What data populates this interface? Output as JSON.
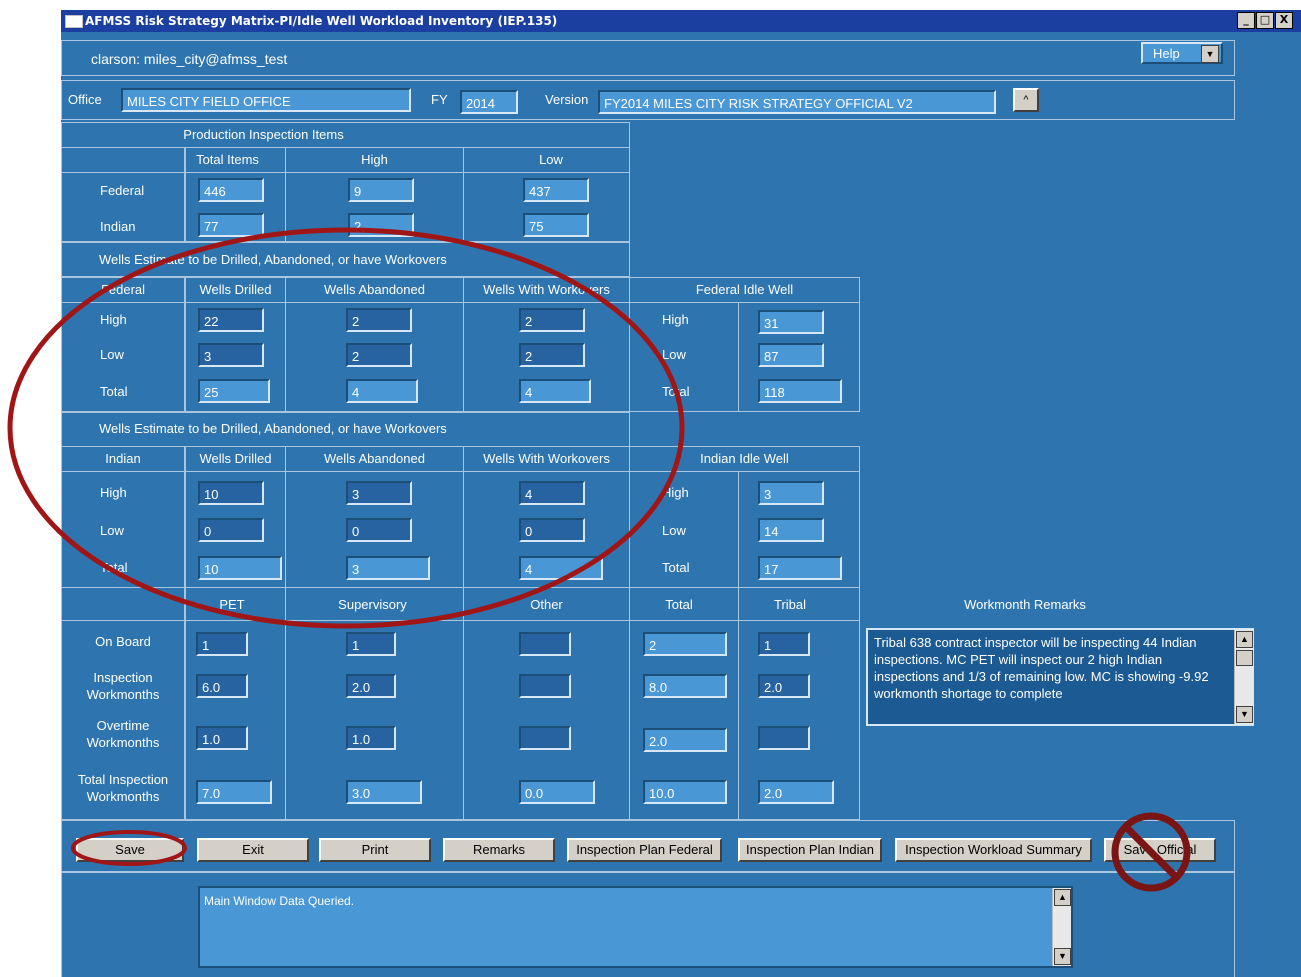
{
  "window": {
    "title": "AFMSS Risk Strategy Matrix-PI/Idle Well Workload Inventory (IEP.135)",
    "user": "clarson: miles_city@afmss_test",
    "help_label": "Help",
    "control_minimize": "_",
    "control_maximize": "□",
    "control_close": "X"
  },
  "header": {
    "office_label": "Office",
    "office_value": "MILES CITY FIELD OFFICE",
    "fy_label": "FY",
    "fy_value": "2014",
    "version_label": "Version",
    "version_value": "FY2014  MILES  CITY  RISK STRATEGY  OFFICIAL  V2",
    "version_button": "^"
  },
  "production": {
    "section_title": "Production Inspection Items",
    "col_total": "Total Items",
    "col_high": "High",
    "col_low": "Low",
    "federal_label": "Federal",
    "indian_label": "Indian",
    "federal": {
      "total": "446",
      "high": "9",
      "low": "437"
    },
    "indian": {
      "total": "77",
      "high": "2",
      "low": "75"
    }
  },
  "federal_wells": {
    "section_title": "Wells Estimate to be Drilled, Abandoned, or have Workovers",
    "col_type": "Federal",
    "col_drilled": "Wells Drilled",
    "col_abandoned": "Wells Abandoned",
    "col_workovers": "Wells With Workovers",
    "col_idle": "Federal Idle Well",
    "row_high": "High",
    "row_low": "Low",
    "row_total": "Total",
    "high": {
      "drilled": "22",
      "abandoned": "2",
      "workovers": "2",
      "idle": "31"
    },
    "low": {
      "drilled": "3",
      "abandoned": "2",
      "workovers": "2",
      "idle": "87"
    },
    "total": {
      "drilled": "25",
      "abandoned": "4",
      "workovers": "4",
      "idle": "118"
    },
    "idle_high": "High",
    "idle_low": "Low",
    "idle_total": "Total"
  },
  "indian_wells": {
    "section_title": "Wells Estimate to be Drilled, Abandoned, or have Workovers",
    "col_type": "Indian",
    "col_drilled": "Wells Drilled",
    "col_abandoned": "Wells Abandoned",
    "col_workovers": "Wells With Workovers",
    "col_idle": "Indian Idle Well",
    "row_high": "High",
    "row_low": "Low",
    "row_total": "Total",
    "high": {
      "drilled": "10",
      "abandoned": "3",
      "workovers": "4",
      "idle": "3"
    },
    "low": {
      "drilled": "0",
      "abandoned": "0",
      "workovers": "0",
      "idle": "14"
    },
    "total": {
      "drilled": "10",
      "abandoned": "3",
      "workovers": "4",
      "idle": "17"
    },
    "idle_high": "High",
    "idle_low": "Low",
    "idle_total": "Total"
  },
  "workmonths": {
    "col_pet": "PET",
    "col_supervisory": "Supervisory",
    "col_other": "Other",
    "col_total": "Total",
    "col_tribal": "Tribal",
    "row_onboard": "On Board",
    "row_inspection_1": "Inspection",
    "row_inspection_2": "Workmonths",
    "row_overtime_1": "Overtime",
    "row_overtime_2": "Workmonths",
    "row_totalinsp_1": "Total Inspection",
    "row_totalinsp_2": "Workmonths",
    "onboard": {
      "pet": "1",
      "supervisory": "1",
      "other": "",
      "total": "2",
      "tribal": "1"
    },
    "inspection": {
      "pet": "6.0",
      "supervisory": "2.0",
      "other": "",
      "total": "8.0",
      "tribal": "2.0"
    },
    "overtime": {
      "pet": "1.0",
      "supervisory": "1.0",
      "other": "",
      "total": "2.0",
      "tribal": ""
    },
    "total_inspection": {
      "pet": "7.0",
      "supervisory": "3.0",
      "other": "0.0",
      "total": "10.0",
      "tribal": "2.0"
    },
    "remarks_label": "Workmonth Remarks",
    "remarks_text": "Tribal 638 contract inspector will be inspecting 44 Indian inspections. MC PET will inspect our 2 high Indian inspections and 1/3 of remaining low.  MC is showing -9.92 workmonth shortage to complete"
  },
  "buttons": {
    "save": "Save",
    "exit": "Exit",
    "print": "Print",
    "remarks": "Remarks",
    "plan_federal": "Inspection Plan Federal",
    "plan_indian": "Inspection Plan Indian",
    "workload_summary": "Inspection Workload Summary",
    "save_official": "Save Official"
  },
  "status": {
    "message": "Main Window Data Queried."
  },
  "annotations": {
    "ellipse_color": "#a01616"
  }
}
